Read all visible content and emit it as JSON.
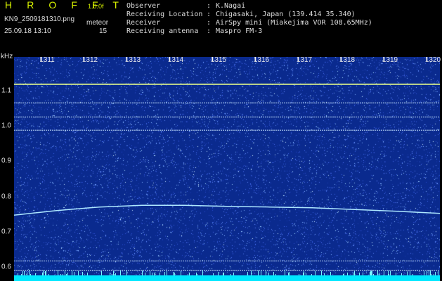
{
  "header": {
    "brand": "H R O F F T",
    "version": "1.0.0f",
    "filename": "KN9_2509181310.png",
    "meteor_label": "meteor",
    "datetime": "25.09.18 13:10",
    "meteor_count": "15"
  },
  "metadata": [
    {
      "key": "Observer",
      "value": "K.Nagai"
    },
    {
      "key": "Receiving Location",
      "value": "Chigasaki, Japan (139.414 35.340)"
    },
    {
      "key": "Receiver",
      "value": "AirSpy mini (Miakejima VOR 108.65MHz)"
    },
    {
      "key": "Receiving antenna",
      "value": "Maspro FM-3"
    }
  ],
  "spectrogram": {
    "y_unit": "kHz",
    "x_ticks": [
      "1311",
      "1312",
      "1313",
      "1314",
      "1315",
      "1316",
      "1317",
      "1318",
      "1319",
      "1320"
    ],
    "y_ticks": [
      "1.1",
      "1.0",
      "0.9",
      "0.8",
      "0.7",
      "0.6"
    ],
    "colors": {
      "background": "#0a2a8e",
      "trace": "#f0ff90",
      "floor": "#00e8ff"
    },
    "carriers_khz": [
      1.118,
      1.065,
      1.025,
      0.988,
      0.617,
      0.59
    ],
    "drifting_trace_khz": [
      0.747,
      0.76,
      0.77,
      0.775,
      0.775,
      0.772,
      0.77,
      0.768,
      0.763,
      0.758,
      0.752
    ]
  }
}
